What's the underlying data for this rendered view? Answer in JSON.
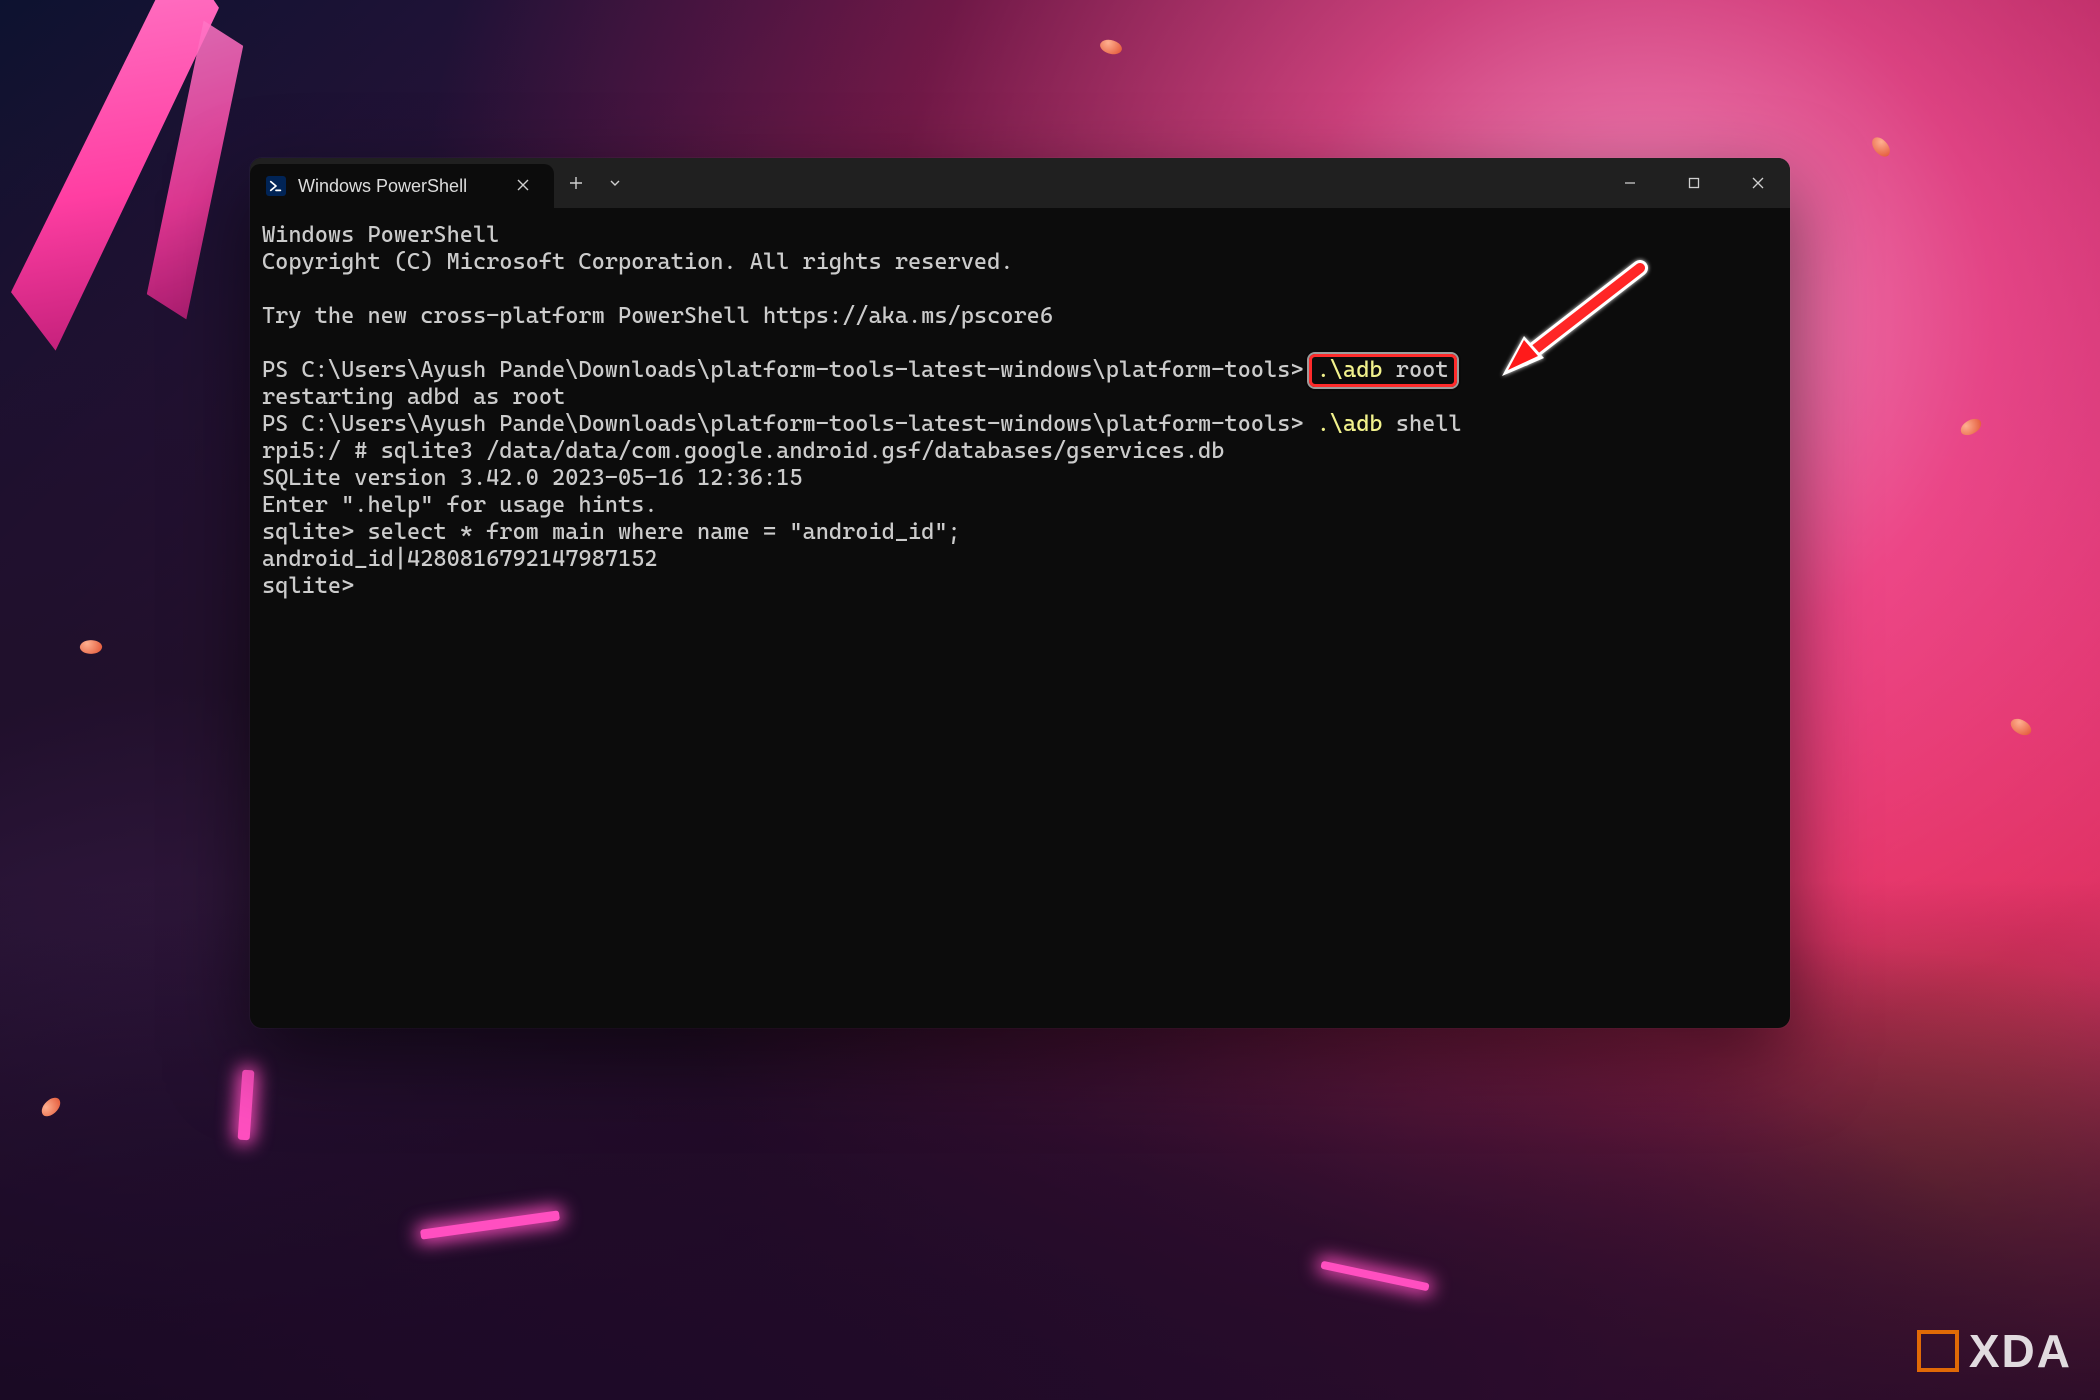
{
  "watermark": {
    "text": "XDA"
  },
  "window": {
    "tab_title": "Windows PowerShell",
    "controls": {
      "close_tab_tooltip": "Close tab",
      "new_tab_tooltip": "New tab",
      "tab_dropdown_tooltip": "New tab dropdown",
      "minimize_tooltip": "Minimize",
      "maximize_tooltip": "Maximize",
      "close_tooltip": "Close"
    }
  },
  "terminal": {
    "banner_line1": "Windows PowerShell",
    "banner_line2": "Copyright (C) Microsoft Corporation. All rights reserved.",
    "try_line": "Try the new cross-platform PowerShell https://aka.ms/pscore6",
    "prompt1_prefix": "PS C:\\Users\\Ayush Pande\\Downloads\\platform-tools-latest-windows\\platform-tools> ",
    "cmd1_yellow": ".\\adb",
    "cmd1_rest": " root",
    "line_restart": "restarting adbd as root",
    "prompt2_prefix": "PS C:\\Users\\Ayush Pande\\Downloads\\platform-tools-latest-windows\\platform-tools> ",
    "cmd2_yellow": ".\\adb",
    "cmd2_rest": " shell",
    "rpi_prompt": "rpi5:/ # sqlite3 /data/data/com.google.android.gsf/databases/gservices.db",
    "sqlite_ver": "SQLite version 3.42.0 2023-05-16 12:36:15",
    "sqlite_help": "Enter \".help\" for usage hints.",
    "sqlite_select": "sqlite> select * from main where name = \"android_id\";",
    "sqlite_result": "android_id|4280816792147987152",
    "sqlite_prompt": "sqlite>"
  }
}
